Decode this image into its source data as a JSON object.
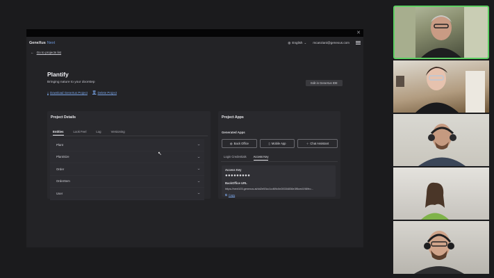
{
  "header": {
    "brand": "GeneXus",
    "brand_sub": "Next",
    "language": "English",
    "user_email": "mcanziani@genexus.com"
  },
  "nav": {
    "back_label": "Go to projects list"
  },
  "project": {
    "title": "Plantify",
    "subtitle": "Bringing nature to your doorstep",
    "download_label": "Download GeneXus Project",
    "delete_label": "Delete Project",
    "edit_label": "Edit in GeneXus IDE"
  },
  "details": {
    "title": "Project Details",
    "tabs": [
      "Entities",
      "Look Feel",
      "Log",
      "Versioning"
    ],
    "entities": [
      "Plant",
      "PlantSize",
      "Order",
      "OrderItem",
      "User"
    ]
  },
  "apps": {
    "title": "Project Apps",
    "generated_label": "Generated Apps",
    "buttons": [
      "Back Office",
      "Mobile App",
      "Chat Assistant"
    ],
    "sub_tabs": [
      "Login Credentials",
      "Access Key"
    ],
    "access_key_label": "Access Key",
    "access_key_masked": "●●●●●●●●●",
    "backoffice_label": "BackOffice URL",
    "backoffice_url": "https://next103.genexus.ai/dd2e53cc1cd69c0e28334836e3f5ced198/fro...",
    "copy_label": "Copy"
  },
  "colors": {
    "accent_link": "#7aa6ea",
    "active_speaker_border": "#5dcf62"
  },
  "participants": [
    {
      "icon": "participant-video"
    },
    {
      "icon": "participant-video"
    },
    {
      "icon": "participant-video"
    },
    {
      "icon": "participant-video"
    },
    {
      "icon": "participant-video"
    }
  ]
}
